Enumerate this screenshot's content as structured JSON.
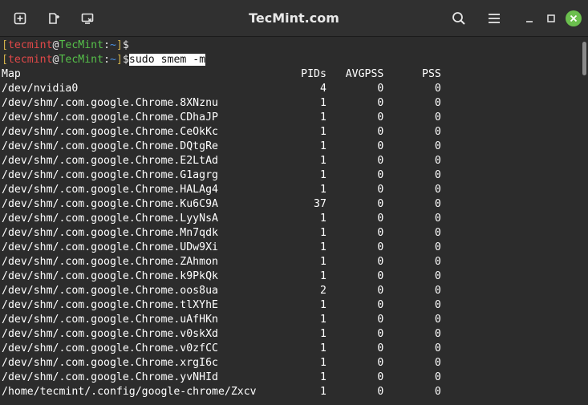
{
  "window": {
    "title": "TecMint.com"
  },
  "icons": {
    "new_tab": "new-tab-icon",
    "export": "export-icon",
    "remote": "remote-session-icon",
    "search": "search-icon",
    "menu": "hamburger-menu-icon",
    "minimize": "minimize-icon",
    "maximize": "maximize-icon",
    "close": "close-icon"
  },
  "colors": {
    "close_button": "#6bbf4e",
    "prompt_user": "#e04848",
    "prompt_host": "#56c04a",
    "prompt_path": "#4a8fe0",
    "prompt_bracket": "#d0b04a"
  },
  "prompt": {
    "open_bracket": "[",
    "user": "tecmint",
    "at": "@",
    "host": "TecMint",
    "colon": ":",
    "path": "~",
    "close_bracket": "]",
    "dollar": "$"
  },
  "command": "sudo smem -m",
  "header_line": "Map                                            PIDs   AVGPSS      PSS ",
  "lines": [
    "/dev/nvidia0                                      4        0        0 ",
    "/dev/shm/.com.google.Chrome.8XNznu                1        0        0 ",
    "/dev/shm/.com.google.Chrome.CDhaJP                1        0        0 ",
    "/dev/shm/.com.google.Chrome.CeOkKc                1        0        0 ",
    "/dev/shm/.com.google.Chrome.DQtgRe                1        0        0 ",
    "/dev/shm/.com.google.Chrome.E2LtAd                1        0        0 ",
    "/dev/shm/.com.google.Chrome.G1agrg                1        0        0 ",
    "/dev/shm/.com.google.Chrome.HALAg4                1        0        0 ",
    "/dev/shm/.com.google.Chrome.Ku6C9A               37        0        0 ",
    "/dev/shm/.com.google.Chrome.LyyNsA                1        0        0 ",
    "/dev/shm/.com.google.Chrome.Mn7qdk                1        0        0 ",
    "/dev/shm/.com.google.Chrome.UDw9Xi                1        0        0 ",
    "/dev/shm/.com.google.Chrome.ZAhmon                1        0        0 ",
    "/dev/shm/.com.google.Chrome.k9PkQk                1        0        0 ",
    "/dev/shm/.com.google.Chrome.oos8ua                2        0        0 ",
    "/dev/shm/.com.google.Chrome.tlXYhE                1        0        0 ",
    "/dev/shm/.com.google.Chrome.uAfHKn                1        0        0 ",
    "/dev/shm/.com.google.Chrome.v0skXd                1        0        0 ",
    "/dev/shm/.com.google.Chrome.v0zfCC                1        0        0 ",
    "/dev/shm/.com.google.Chrome.xrgI6c                1        0        0 ",
    "/dev/shm/.com.google.Chrome.yvNHId                1        0        0 ",
    "/home/tecmint/.config/google-chrome/Zxcv          1        0        0 "
  ]
}
